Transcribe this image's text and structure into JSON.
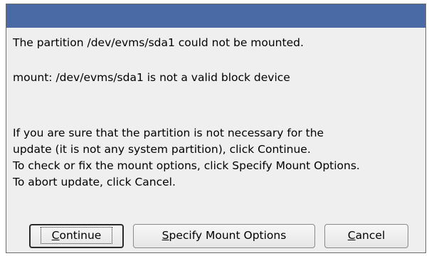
{
  "dialog": {
    "title": "",
    "lines": [
      "The partition /dev/evms/sda1 could not be mounted.",
      "mount: /dev/evms/sda1 is not a valid block device",
      "If you are sure that the partition is not necessary for the",
      "update (it is not any system partition), click Continue.",
      "To check or fix the mount options, click Specify Mount Options.",
      "To abort update, click Cancel."
    ],
    "buttons": {
      "continue": {
        "mnemonic": "C",
        "rest": "ontinue"
      },
      "specify": {
        "mnemonic": "S",
        "rest": "pecify Mount Options"
      },
      "cancel": {
        "mnemonic": "C",
        "rest": "ancel"
      }
    }
  },
  "colors": {
    "titlebar": "#4a6aa6",
    "dialog_background": "#efefef"
  }
}
